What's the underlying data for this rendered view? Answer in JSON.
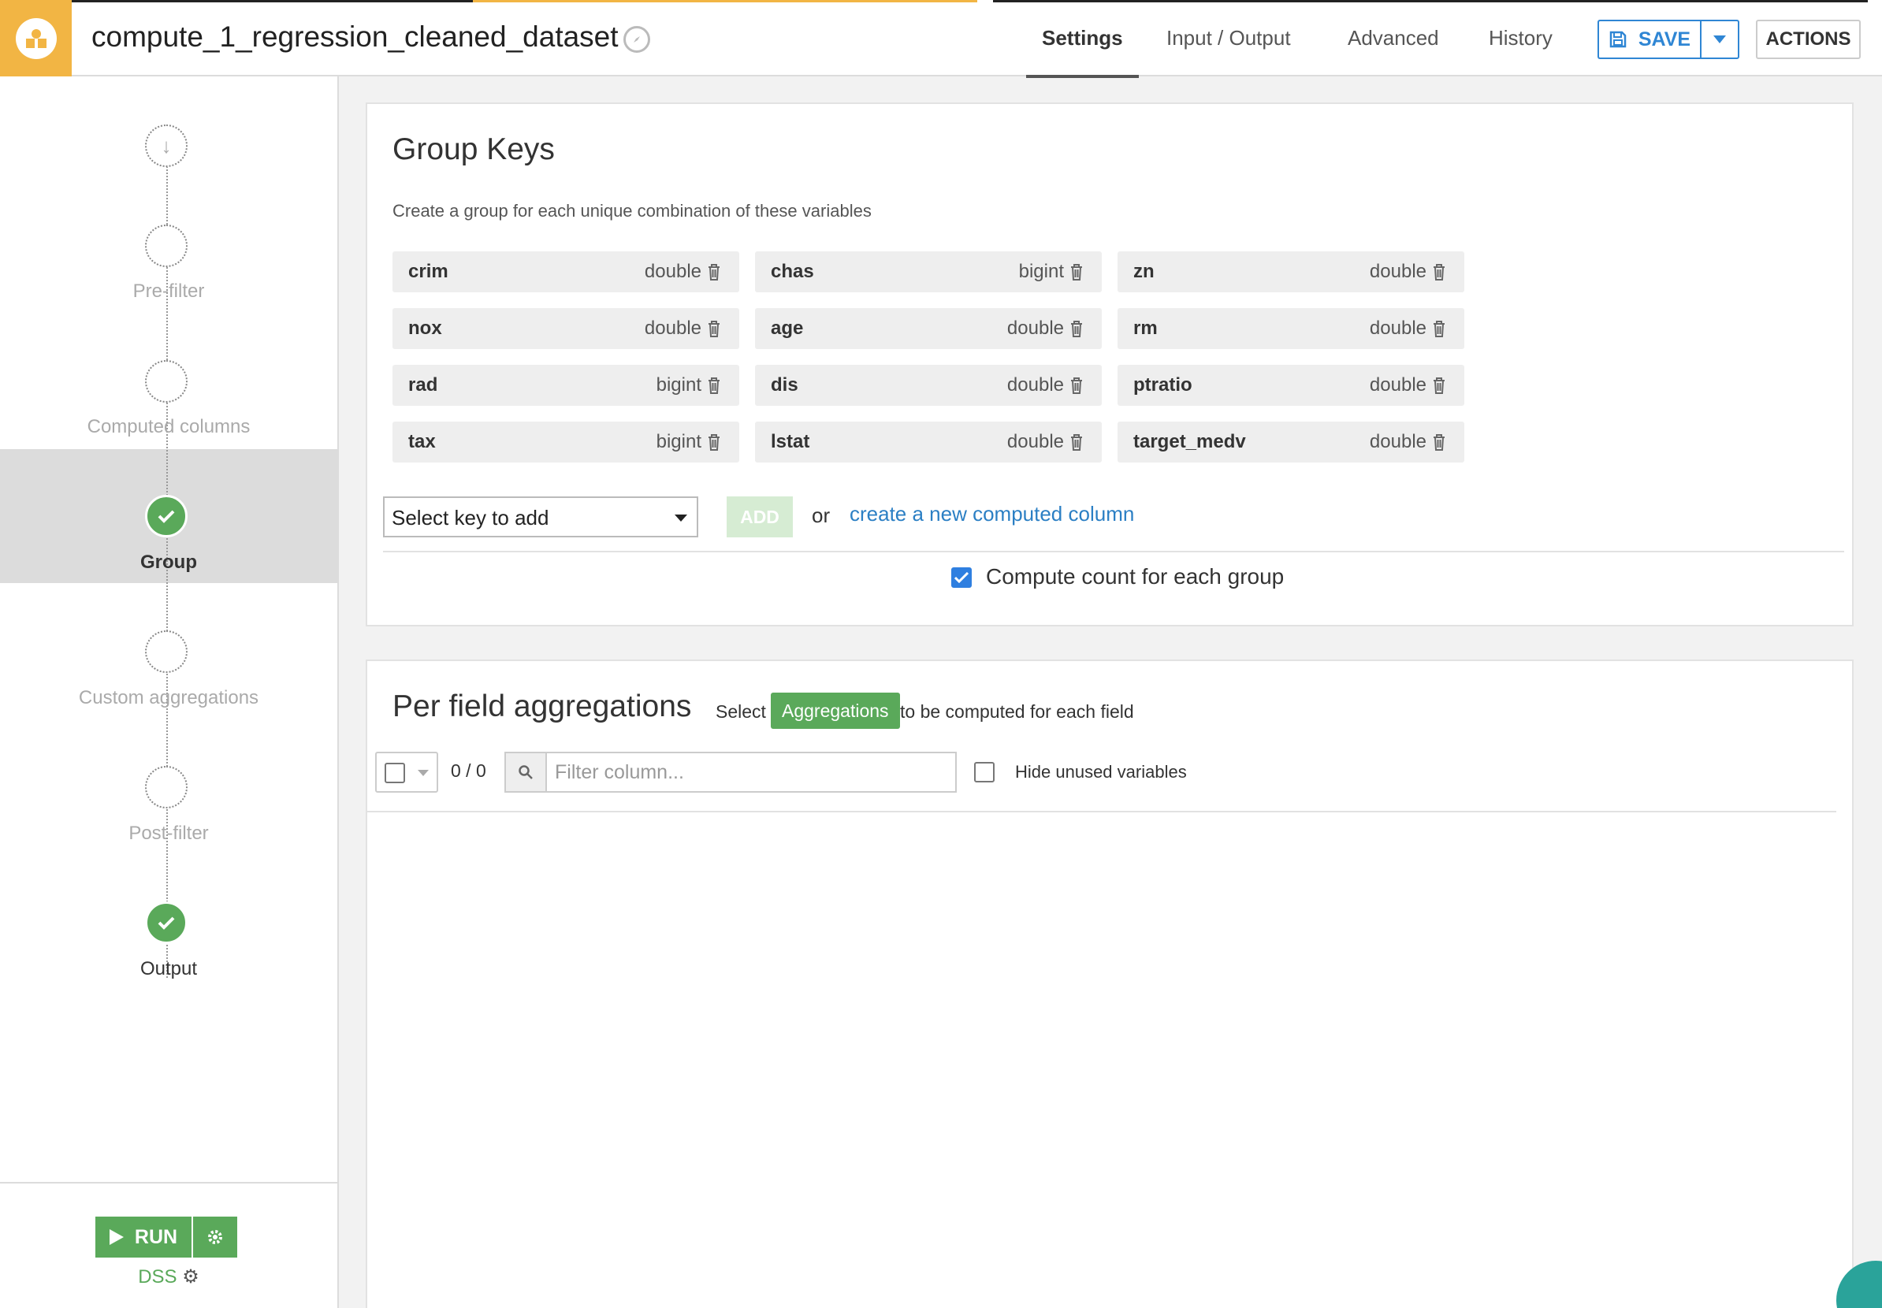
{
  "header": {
    "title": "compute_1_regression_cleaned_dataset",
    "tabs": [
      {
        "label": "Settings",
        "active": true
      },
      {
        "label": "Input / Output",
        "active": false
      },
      {
        "label": "Advanced",
        "active": false
      },
      {
        "label": "History",
        "active": false
      }
    ],
    "save_label": "SAVE",
    "actions_label": "ACTIONS",
    "accent_color": "#f2b544",
    "save_color": "#2f86d4"
  },
  "steps": [
    {
      "label": "",
      "state": "start"
    },
    {
      "label": "Pre-filter",
      "state": "pending"
    },
    {
      "label": "Computed columns",
      "state": "pending"
    },
    {
      "label": "Group",
      "state": "done-active"
    },
    {
      "label": "Custom aggregations",
      "state": "pending"
    },
    {
      "label": "Post-filter",
      "state": "pending"
    },
    {
      "label": "Output",
      "state": "done"
    }
  ],
  "run": {
    "run_label": "RUN",
    "engine_label": "DSS",
    "color": "#5aa95a"
  },
  "group_keys": {
    "title": "Group Keys",
    "subtitle": "Create a group for each unique combination of these variables",
    "keys": [
      {
        "name": "crim",
        "type": "double"
      },
      {
        "name": "chas",
        "type": "bigint"
      },
      {
        "name": "zn",
        "type": "double"
      },
      {
        "name": "nox",
        "type": "double"
      },
      {
        "name": "age",
        "type": "double"
      },
      {
        "name": "rm",
        "type": "double"
      },
      {
        "name": "rad",
        "type": "bigint"
      },
      {
        "name": "dis",
        "type": "double"
      },
      {
        "name": "ptratio",
        "type": "double"
      },
      {
        "name": "tax",
        "type": "bigint"
      },
      {
        "name": "lstat",
        "type": "double"
      },
      {
        "name": "target_medv",
        "type": "double"
      }
    ],
    "select_placeholder": "Select key to add",
    "add_label": "ADD",
    "or_text": "or",
    "new_column_link": "create a new computed column",
    "compute_count_label": "Compute count for each group",
    "compute_count_checked": true
  },
  "aggregations": {
    "title": "Per field aggregations",
    "select_text": "Select",
    "badge_label": "Aggregations",
    "after_text": "to be computed for each field",
    "count": "0 / 0",
    "filter_placeholder": "Filter column...",
    "hide_unused_label": "Hide unused variables"
  }
}
